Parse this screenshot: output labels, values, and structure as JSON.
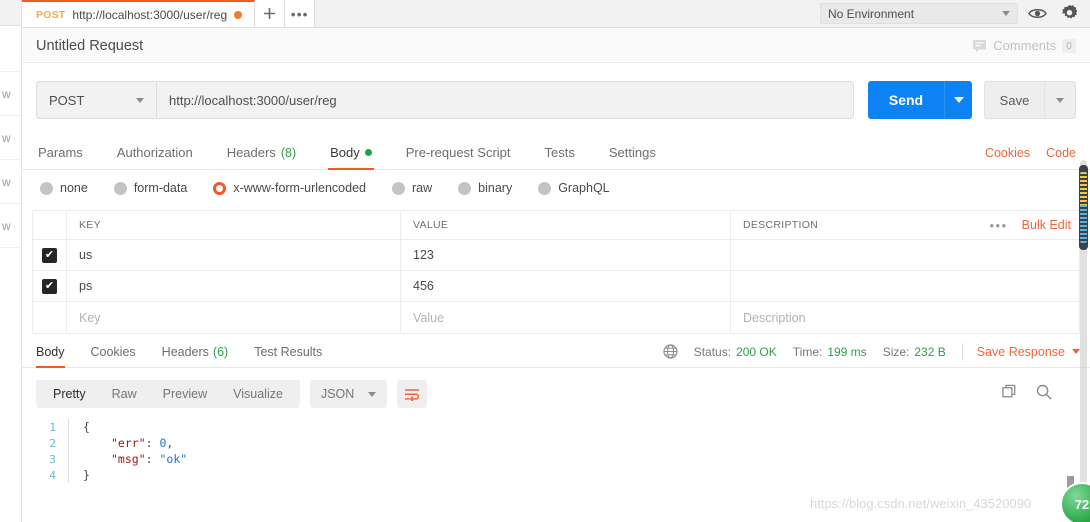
{
  "tab_bar": {
    "request_tab": {
      "method": "POST",
      "url": "http://localhost:3000/user/reg",
      "unsaved_indicator": "unsaved-dot"
    },
    "new_tab_label": "+",
    "more_tabs_label": "•••",
    "environment": {
      "selected": "No Environment",
      "caret_icon": "chevron-down-icon"
    },
    "eye_icon": "eye-icon",
    "settings_icon": "gear-icon"
  },
  "title_row": {
    "request_name": "Untitled Request",
    "comments_label": "Comments",
    "comments_count": "0",
    "comments_icon": "comment-icon"
  },
  "url_bar": {
    "method": "POST",
    "method_caret": "chevron-down-icon",
    "url": "http://localhost:3000/user/reg",
    "send_label": "Send",
    "send_caret": "chevron-down-icon",
    "save_label": "Save",
    "save_caret": "chevron-down-icon",
    "accent_blue": "#0d82f5"
  },
  "request_tabs": {
    "items": [
      {
        "label": "Params",
        "active": false,
        "badge": "",
        "dot": false
      },
      {
        "label": "Authorization",
        "active": false,
        "badge": "",
        "dot": false
      },
      {
        "label": "Headers",
        "active": false,
        "badge": "(8)",
        "dot": false
      },
      {
        "label": "Body",
        "active": true,
        "badge": "",
        "dot": true
      },
      {
        "label": "Pre-request Script",
        "active": false,
        "badge": "",
        "dot": false
      },
      {
        "label": "Tests",
        "active": false,
        "badge": "",
        "dot": false
      },
      {
        "label": "Settings",
        "active": false,
        "badge": "",
        "dot": false
      }
    ],
    "cookies_label": "Cookies",
    "code_label": "Code",
    "accent_orange": "#f1643a",
    "badge_green": "#30a14e"
  },
  "body_types": {
    "options": [
      {
        "label": "none",
        "selected": false
      },
      {
        "label": "form-data",
        "selected": false
      },
      {
        "label": "x-www-form-urlencoded",
        "selected": true
      },
      {
        "label": "raw",
        "selected": false
      },
      {
        "label": "binary",
        "selected": false
      },
      {
        "label": "GraphQL",
        "selected": false
      }
    ]
  },
  "kv_table": {
    "headers": {
      "key": "KEY",
      "value": "VALUE",
      "description": "DESCRIPTION"
    },
    "more_icon": "•••",
    "bulk_edit_label": "Bulk Edit",
    "rows": [
      {
        "checked": true,
        "key": "us",
        "value": "123",
        "description": ""
      },
      {
        "checked": true,
        "key": "ps",
        "value": "456",
        "description": ""
      },
      {
        "checked": false,
        "key": "Key",
        "value": "Value",
        "description": "Description",
        "placeholder_row": true
      }
    ],
    "check_glyph": "✔"
  },
  "response": {
    "tabs": [
      {
        "label": "Body",
        "active": true,
        "badge": ""
      },
      {
        "label": "Cookies",
        "active": false,
        "badge": ""
      },
      {
        "label": "Headers",
        "active": false,
        "badge": "(6)"
      },
      {
        "label": "Test Results",
        "active": false,
        "badge": ""
      }
    ],
    "globe_icon": "globe-icon",
    "status_label": "Status:",
    "status_value": "200 OK",
    "time_label": "Time:",
    "time_value": "199 ms",
    "size_label": "Size:",
    "size_value": "232 B",
    "save_response_label": "Save Response",
    "save_response_caret": "chevron-down-icon",
    "status_green": "#2f9e44"
  },
  "response_toolbar": {
    "formats": [
      {
        "label": "Pretty",
        "active": true
      },
      {
        "label": "Raw",
        "active": false
      },
      {
        "label": "Preview",
        "active": false
      },
      {
        "label": "Visualize",
        "active": false
      }
    ],
    "language": "JSON",
    "language_caret": "chevron-down-icon",
    "wrap_icon": "word-wrap-icon",
    "copy_icon": "copy-icon",
    "search_icon": "search-icon"
  },
  "code_viewer": {
    "lines": [
      {
        "no": "1",
        "indent": 0,
        "segments": [
          {
            "t": "{",
            "c": "tok-brace"
          }
        ]
      },
      {
        "no": "2",
        "indent": 1,
        "segments": [
          {
            "t": "\"err\"",
            "c": "tok-key"
          },
          {
            "t": ": ",
            "c": "tok-punc"
          },
          {
            "t": "0",
            "c": "tok-num"
          },
          {
            "t": ",",
            "c": "tok-punc"
          }
        ]
      },
      {
        "no": "3",
        "indent": 1,
        "segments": [
          {
            "t": "\"msg\"",
            "c": "tok-key"
          },
          {
            "t": ": ",
            "c": "tok-punc"
          },
          {
            "t": "\"ok\"",
            "c": "tok-str"
          }
        ]
      },
      {
        "no": "4",
        "indent": 0,
        "segments": [
          {
            "t": "}",
            "c": "tok-brace"
          }
        ]
      }
    ]
  },
  "left_strip": {
    "items": [
      "w",
      "w",
      "w",
      "w"
    ]
  },
  "overlays": {
    "watermark": "https://blog.csdn.net/weixin_43520090",
    "badge_text": "72"
  }
}
